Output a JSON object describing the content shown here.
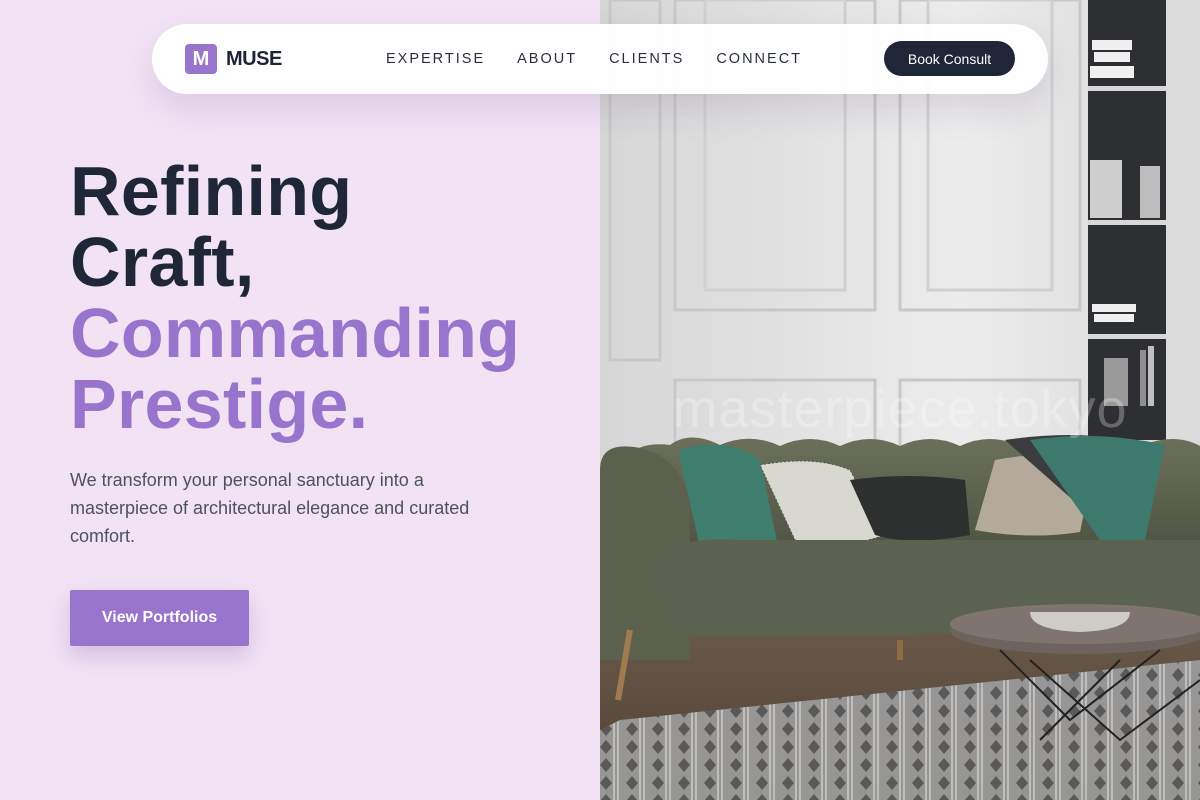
{
  "brand": {
    "mark": "M",
    "name": "MUSE"
  },
  "nav": {
    "items": [
      "EXPERTISE",
      "ABOUT",
      "CLIENTS",
      "CONNECT"
    ],
    "cta": "Book Consult"
  },
  "hero": {
    "line1": "Refining",
    "line2": "Craft,",
    "line3": "Commanding",
    "line4": "Prestige.",
    "subtitle": "We transform your personal sanctuary into a masterpiece of architectural elegance and curated comfort.",
    "button": "View Portfolios"
  },
  "image": {
    "watermark": "masterpiece.tokyo"
  },
  "colors": {
    "background": "#f1e3f4",
    "accent": "#9874cd",
    "dark": "#1e2638"
  }
}
